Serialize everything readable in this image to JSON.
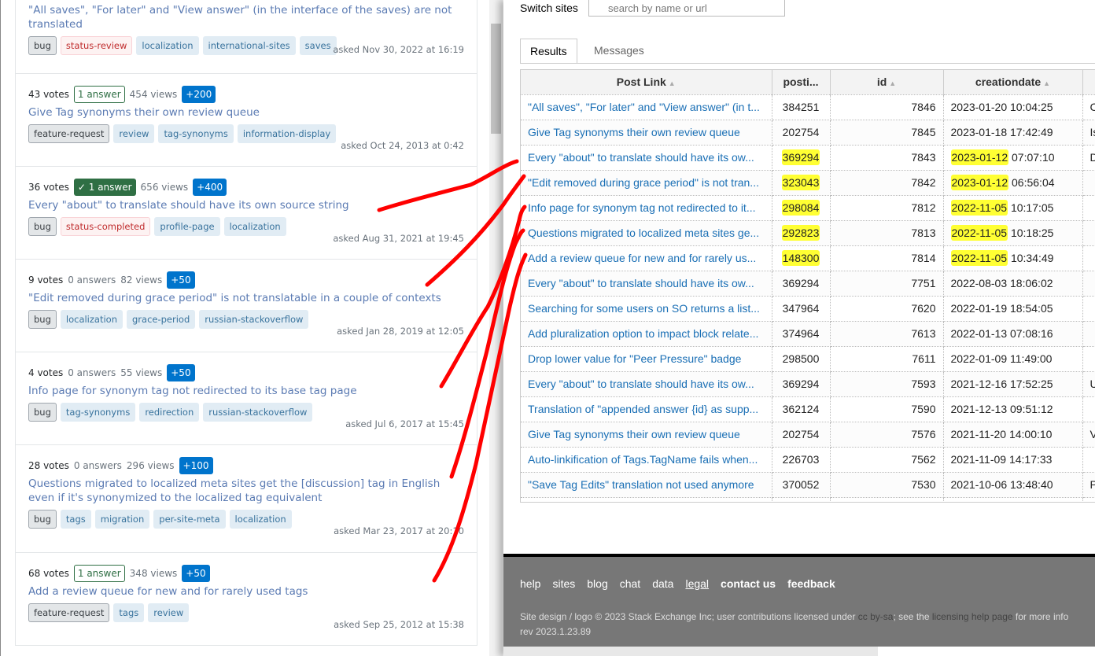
{
  "questions": [
    {
      "votes": "",
      "answers": "",
      "answers_style": "none",
      "views": "",
      "bounty": "",
      "title": "\"All saves\", \"For later\" and \"View answer\" (in the interface of the saves) are not translated",
      "tags": [
        {
          "t": "bug",
          "k": "req"
        },
        {
          "t": "status-review",
          "k": "mod"
        },
        {
          "t": "localization",
          "k": ""
        },
        {
          "t": "international-sites",
          "k": ""
        },
        {
          "t": "saves",
          "k": ""
        }
      ],
      "asked": "asked Nov 30, 2022 at 16:19"
    },
    {
      "votes": "43 votes",
      "answers": "1 answer",
      "answers_style": "outline",
      "views": "454 views",
      "bounty": "+200",
      "title": "Give Tag synonyms their own review queue",
      "tags": [
        {
          "t": "feature-request",
          "k": "req"
        },
        {
          "t": "review",
          "k": ""
        },
        {
          "t": "tag-synonyms",
          "k": ""
        },
        {
          "t": "information-display",
          "k": ""
        }
      ],
      "asked": "asked Oct 24, 2013 at 0:42"
    },
    {
      "votes": "36 votes",
      "answers": "✓ 1 answer",
      "answers_style": "accepted",
      "views": "656 views",
      "bounty": "+400",
      "title": "Every \"about\" to translate should have its own source string",
      "tags": [
        {
          "t": "bug",
          "k": "req"
        },
        {
          "t": "status-completed",
          "k": "mod"
        },
        {
          "t": "profile-page",
          "k": ""
        },
        {
          "t": "localization",
          "k": ""
        }
      ],
      "asked": "asked Aug 31, 2021 at 19:45"
    },
    {
      "votes": "9 votes",
      "answers": "0 answers",
      "answers_style": "plain",
      "views": "82 views",
      "bounty": "+50",
      "title": "\"Edit removed during grace period\" is not translatable in a couple of contexts",
      "tags": [
        {
          "t": "bug",
          "k": "req"
        },
        {
          "t": "localization",
          "k": ""
        },
        {
          "t": "grace-period",
          "k": ""
        },
        {
          "t": "russian-stackoverflow",
          "k": ""
        }
      ],
      "asked": "asked Jan 28, 2019 at 12:05"
    },
    {
      "votes": "4 votes",
      "answers": "0 answers",
      "answers_style": "plain",
      "views": "55 views",
      "bounty": "+50",
      "title": "Info page for synonym tag not redirected to its base tag page",
      "tags": [
        {
          "t": "bug",
          "k": "req"
        },
        {
          "t": "tag-synonyms",
          "k": ""
        },
        {
          "t": "redirection",
          "k": ""
        },
        {
          "t": "russian-stackoverflow",
          "k": ""
        }
      ],
      "asked": "asked Jul 6, 2017 at 15:45"
    },
    {
      "votes": "28 votes",
      "answers": "0 answers",
      "answers_style": "plain",
      "views": "296 views",
      "bounty": "+100",
      "title": "Questions migrated to localized meta sites get the [discussion] tag in English even if it's synonymized to the localized tag equivalent",
      "tags": [
        {
          "t": "bug",
          "k": "req"
        },
        {
          "t": "tags",
          "k": ""
        },
        {
          "t": "migration",
          "k": ""
        },
        {
          "t": "per-site-meta",
          "k": ""
        },
        {
          "t": "localization",
          "k": ""
        }
      ],
      "asked": "asked Mar 23, 2017 at 20:10"
    },
    {
      "votes": "68 votes",
      "answers": "1 answer",
      "answers_style": "outline",
      "views": "348 views",
      "bounty": "+50",
      "title": "Add a review queue for new and for rarely used tags",
      "tags": [
        {
          "t": "feature-request",
          "k": "req"
        },
        {
          "t": "tags",
          "k": ""
        },
        {
          "t": "review",
          "k": ""
        }
      ],
      "asked": "asked Sep 25, 2012 at 15:38"
    }
  ],
  "sede": {
    "switch_label": "Switch sites",
    "switch_placeholder": "search by name or url",
    "tabs": [
      "Results",
      "Messages"
    ],
    "columns": [
      "Post Link",
      "posti...",
      "id",
      "creationdate",
      ""
    ],
    "rows": [
      {
        "link": "\"All saves\", \"For later\" and \"View answer\" (in t...",
        "post": "384251",
        "id": "7846",
        "date": "2023-01-20",
        "time": " 10:04:25",
        "extra": "C",
        "hl_post": false,
        "hl_date": false
      },
      {
        "link": "Give Tag synonyms their own review queue",
        "post": "202754",
        "id": "7845",
        "date": "2023-01-18",
        "time": " 17:42:49",
        "extra": "Is",
        "hl_post": false,
        "hl_date": false
      },
      {
        "link": "Every \"about\" to translate should have its ow...",
        "post": "369294",
        "id": "7843",
        "date": "2023-01-12",
        "time": " 07:07:10",
        "extra": "D",
        "hl_post": true,
        "hl_date": true
      },
      {
        "link": "\"Edit removed during grace period\" is not tran...",
        "post": "323043",
        "id": "7842",
        "date": "2023-01-12",
        "time": " 06:56:04",
        "extra": "",
        "hl_post": true,
        "hl_date": true
      },
      {
        "link": "Info page for synonym tag not redirected to it...",
        "post": "298084",
        "id": "7812",
        "date": "2022-11-05",
        "time": " 10:17:05",
        "extra": "",
        "hl_post": true,
        "hl_date": true
      },
      {
        "link": "Questions migrated to localized meta sites ge...",
        "post": "292823",
        "id": "7813",
        "date": "2022-11-05",
        "time": " 10:18:25",
        "extra": "",
        "hl_post": true,
        "hl_date": true
      },
      {
        "link": "Add a review queue for new and for rarely us...",
        "post": "148300",
        "id": "7814",
        "date": "2022-11-05",
        "time": " 10:34:49",
        "extra": "",
        "hl_post": true,
        "hl_date": true
      },
      {
        "link": "Every \"about\" to translate should have its ow...",
        "post": "369294",
        "id": "7751",
        "date": "2022-08-03",
        "time": " 18:06:02",
        "extra": "",
        "hl_post": false,
        "hl_date": false
      },
      {
        "link": "Searching for some users on SO returns a list...",
        "post": "347964",
        "id": "7620",
        "date": "2022-01-19",
        "time": " 18:54:05",
        "extra": "",
        "hl_post": false,
        "hl_date": false
      },
      {
        "link": "Add pluralization option to impact block relate...",
        "post": "374964",
        "id": "7613",
        "date": "2022-01-13",
        "time": " 07:08:16",
        "extra": "",
        "hl_post": false,
        "hl_date": false
      },
      {
        "link": "Drop lower value for \"Peer Pressure\" badge",
        "post": "298500",
        "id": "7611",
        "date": "2022-01-09",
        "time": " 11:49:00",
        "extra": "",
        "hl_post": false,
        "hl_date": false
      },
      {
        "link": "Every \"about\" to translate should have its ow...",
        "post": "369294",
        "id": "7593",
        "date": "2021-12-16",
        "time": " 17:52:25",
        "extra": "U",
        "hl_post": false,
        "hl_date": false
      },
      {
        "link": "Translation of \"appended answer {id} as supp...",
        "post": "362124",
        "id": "7590",
        "date": "2021-12-13",
        "time": " 09:51:12",
        "extra": "",
        "hl_post": false,
        "hl_date": false
      },
      {
        "link": "Give Tag synonyms their own review queue",
        "post": "202754",
        "id": "7576",
        "date": "2021-11-20",
        "time": " 14:00:10",
        "extra": "V",
        "hl_post": false,
        "hl_date": false
      },
      {
        "link": "Auto-linkification of Tags.TagName fails when...",
        "post": "226703",
        "id": "7562",
        "date": "2021-11-09",
        "time": " 14:17:33",
        "extra": "",
        "hl_post": false,
        "hl_date": false
      },
      {
        "link": "\"Save Tag Edits\" translation not used anymore",
        "post": "370052",
        "id": "7530",
        "date": "2021-10-06",
        "time": " 13:48:40",
        "extra": "P",
        "hl_post": false,
        "hl_date": false
      },
      {
        "link": "",
        "post": "",
        "id": "",
        "date": "",
        "time": "",
        "extra": "",
        "hl_post": false,
        "hl_date": false
      }
    ],
    "footer": {
      "links": [
        {
          "t": "help",
          "s": ""
        },
        {
          "t": "sites",
          "s": ""
        },
        {
          "t": "blog",
          "s": ""
        },
        {
          "t": "chat",
          "s": ""
        },
        {
          "t": "data",
          "s": ""
        },
        {
          "t": "legal",
          "s": "u"
        },
        {
          "t": "contact us",
          "s": "b"
        },
        {
          "t": "feedback",
          "s": "b"
        }
      ],
      "copy_1": "Site design / logo © 2023 Stack Exchange Inc; user contributions licensed under ",
      "cc": "cc by-sa",
      "copy_2": "; see the ",
      "licensing": "licensing help page",
      "copy_3": " for more info",
      "rev": "rev 2023.1.23.89"
    }
  },
  "colors": {
    "annotation": "#ff0000",
    "highlight": "#ffff33",
    "link": "#1a6fb5",
    "bounty": "#0074cc",
    "accepted": "#2f6f44"
  }
}
